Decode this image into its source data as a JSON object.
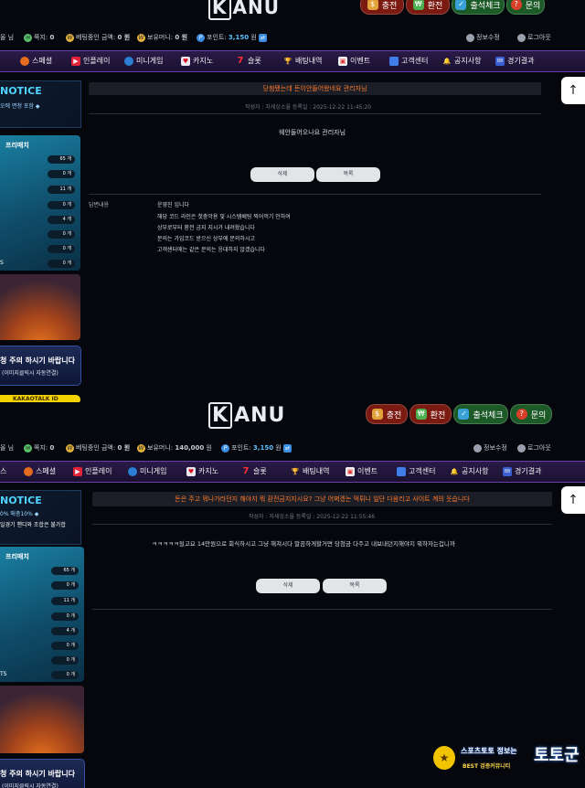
{
  "header": {
    "logo_k": "K",
    "logo_text": "ANU",
    "buttons": [
      {
        "label": "충전",
        "icon": "money-bag-icon",
        "color": "#8a1e12"
      },
      {
        "label": "환전",
        "icon": "cash-icon",
        "color": "#8a1e12"
      },
      {
        "label": "출석체크",
        "icon": "calendar-check-icon",
        "color": "#1f5d2a"
      },
      {
        "label": "문의",
        "icon": "question-icon",
        "color": "#1f5d2a"
      }
    ]
  },
  "info_top": {
    "level_suffix": "올 님",
    "points_label": "쪽지:",
    "points_value": "0",
    "bet_label": "베팅중인 금액:",
    "bet_value": "0 원",
    "money_label": "보유머니:",
    "money_value": "0 원",
    "point_label": "포인트:",
    "point_value": "3,150",
    "point_unit": "원",
    "profile": "정보수정",
    "logout": "로그아웃"
  },
  "info_bottom": {
    "level_suffix": "올 님",
    "points_label": "쪽지:",
    "points_value": "0",
    "bet_label": "베팅중인 금액:",
    "bet_value": "0 원",
    "money_label": "보유머니:",
    "money_value": "140,000",
    "money_unit": "원",
    "point_label": "포인트:",
    "point_value": "3,150",
    "point_unit": "원",
    "profile": "정보수정",
    "logout": "로그아웃"
  },
  "nav_top": [
    "스페셜",
    "인플레이",
    "미니게임",
    "카지노",
    "슬롯",
    "배팅내역",
    "이벤트",
    "고객센터",
    "공지사항",
    "경기결과"
  ],
  "nav_bottom": [
    "스",
    "스페셜",
    "인플레이",
    "미니게임",
    "카지노",
    "슬롯",
    "배팅내역",
    "이벤트",
    "고객센터",
    "공지사항",
    "경기결과"
  ],
  "sidebar": {
    "notice_title": "NOTICE",
    "notice_sub_top": "오에 면청 포함 ◆",
    "notice_sub_bottom": "0% 매충10% ◆",
    "notice_sub_bottom2": "일경기 핸디와 조합은 불가합",
    "freematch_title": "프리매치",
    "counts": [
      "65 개",
      "0 개",
      "11 개",
      "0 개",
      "4 개",
      "0 개",
      "0 개",
      "0 개"
    ],
    "freematch_last_label": "S",
    "freematch_last_label_bottom": "TS",
    "warn_title": "청 주의 하시기 바랍니다",
    "warn_sub": "(이미지클릭시 자동연결)",
    "kakao": "KAKAOTALK ID"
  },
  "post1": {
    "title": "당첨됐는데 돈이안들어왔네요 관리자님",
    "meta": "작성자 : 자세싱소율  등록일 : 2025-12-22 11:45:20",
    "body": "웨안들어오나요 관리자님",
    "delete_label": "삭제",
    "list_label": "목록",
    "answer_label": "답변내용",
    "answer_lines": [
      "운영진 입니다",
      "해당 코드 라인은 첫충악용 및 시스템베팅 찍어먹기 인하여",
      "상부로부터 환전 금지 지시가 내려왔습니다",
      "문의는 가입코드 받으신 상부에 문의하시고",
      "고객센터에는 같은 문의는 응대하지 않겠습니다"
    ]
  },
  "post2": {
    "title": "돈은 주고 뭐나가라던지 해야지 뭐 환전금지지시요? 그냥 어쩌겠는 먹튀니 일단 다음리고 사이트 계의 웃습니다",
    "meta": "작성자 : 자세싱소율  등록일 : 2025-12-22 11:55:46",
    "body": "ㅋㅋㅋㅋㅋ뒀고요 14만원으로 회식하시고 그냥 해쳐시다 말끔하게할거면 당첨금 다주고 내보내던지해야지 뭐하자는겁니까",
    "delete_label": "삭제",
    "list_label": "목록"
  },
  "badge": {
    "top": "스포츠토토 정보는",
    "sub": "BEST 검증커뮤니티",
    "brand": "토토군"
  }
}
